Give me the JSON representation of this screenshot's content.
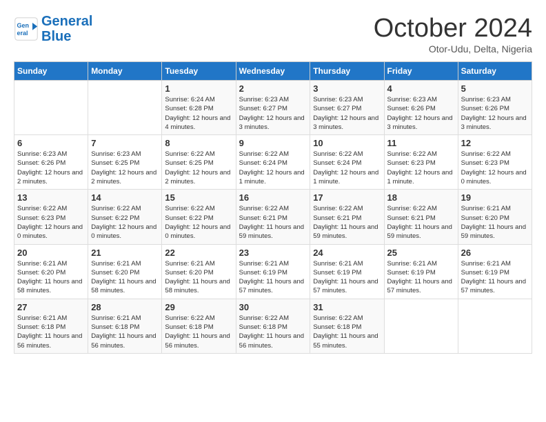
{
  "logo": {
    "line1": "General",
    "line2": "Blue"
  },
  "title": "October 2024",
  "location": "Otor-Udu, Delta, Nigeria",
  "days_of_week": [
    "Sunday",
    "Monday",
    "Tuesday",
    "Wednesday",
    "Thursday",
    "Friday",
    "Saturday"
  ],
  "weeks": [
    [
      {
        "day": "",
        "info": ""
      },
      {
        "day": "",
        "info": ""
      },
      {
        "day": "1",
        "info": "Sunrise: 6:24 AM\nSunset: 6:28 PM\nDaylight: 12 hours and 4 minutes."
      },
      {
        "day": "2",
        "info": "Sunrise: 6:23 AM\nSunset: 6:27 PM\nDaylight: 12 hours and 3 minutes."
      },
      {
        "day": "3",
        "info": "Sunrise: 6:23 AM\nSunset: 6:27 PM\nDaylight: 12 hours and 3 minutes."
      },
      {
        "day": "4",
        "info": "Sunrise: 6:23 AM\nSunset: 6:26 PM\nDaylight: 12 hours and 3 minutes."
      },
      {
        "day": "5",
        "info": "Sunrise: 6:23 AM\nSunset: 6:26 PM\nDaylight: 12 hours and 3 minutes."
      }
    ],
    [
      {
        "day": "6",
        "info": "Sunrise: 6:23 AM\nSunset: 6:26 PM\nDaylight: 12 hours and 2 minutes."
      },
      {
        "day": "7",
        "info": "Sunrise: 6:23 AM\nSunset: 6:25 PM\nDaylight: 12 hours and 2 minutes."
      },
      {
        "day": "8",
        "info": "Sunrise: 6:22 AM\nSunset: 6:25 PM\nDaylight: 12 hours and 2 minutes."
      },
      {
        "day": "9",
        "info": "Sunrise: 6:22 AM\nSunset: 6:24 PM\nDaylight: 12 hours and 1 minute."
      },
      {
        "day": "10",
        "info": "Sunrise: 6:22 AM\nSunset: 6:24 PM\nDaylight: 12 hours and 1 minute."
      },
      {
        "day": "11",
        "info": "Sunrise: 6:22 AM\nSunset: 6:23 PM\nDaylight: 12 hours and 1 minute."
      },
      {
        "day": "12",
        "info": "Sunrise: 6:22 AM\nSunset: 6:23 PM\nDaylight: 12 hours and 0 minutes."
      }
    ],
    [
      {
        "day": "13",
        "info": "Sunrise: 6:22 AM\nSunset: 6:23 PM\nDaylight: 12 hours and 0 minutes."
      },
      {
        "day": "14",
        "info": "Sunrise: 6:22 AM\nSunset: 6:22 PM\nDaylight: 12 hours and 0 minutes."
      },
      {
        "day": "15",
        "info": "Sunrise: 6:22 AM\nSunset: 6:22 PM\nDaylight: 12 hours and 0 minutes."
      },
      {
        "day": "16",
        "info": "Sunrise: 6:22 AM\nSunset: 6:21 PM\nDaylight: 11 hours and 59 minutes."
      },
      {
        "day": "17",
        "info": "Sunrise: 6:22 AM\nSunset: 6:21 PM\nDaylight: 11 hours and 59 minutes."
      },
      {
        "day": "18",
        "info": "Sunrise: 6:22 AM\nSunset: 6:21 PM\nDaylight: 11 hours and 59 minutes."
      },
      {
        "day": "19",
        "info": "Sunrise: 6:21 AM\nSunset: 6:20 PM\nDaylight: 11 hours and 59 minutes."
      }
    ],
    [
      {
        "day": "20",
        "info": "Sunrise: 6:21 AM\nSunset: 6:20 PM\nDaylight: 11 hours and 58 minutes."
      },
      {
        "day": "21",
        "info": "Sunrise: 6:21 AM\nSunset: 6:20 PM\nDaylight: 11 hours and 58 minutes."
      },
      {
        "day": "22",
        "info": "Sunrise: 6:21 AM\nSunset: 6:20 PM\nDaylight: 11 hours and 58 minutes."
      },
      {
        "day": "23",
        "info": "Sunrise: 6:21 AM\nSunset: 6:19 PM\nDaylight: 11 hours and 57 minutes."
      },
      {
        "day": "24",
        "info": "Sunrise: 6:21 AM\nSunset: 6:19 PM\nDaylight: 11 hours and 57 minutes."
      },
      {
        "day": "25",
        "info": "Sunrise: 6:21 AM\nSunset: 6:19 PM\nDaylight: 11 hours and 57 minutes."
      },
      {
        "day": "26",
        "info": "Sunrise: 6:21 AM\nSunset: 6:19 PM\nDaylight: 11 hours and 57 minutes."
      }
    ],
    [
      {
        "day": "27",
        "info": "Sunrise: 6:21 AM\nSunset: 6:18 PM\nDaylight: 11 hours and 56 minutes."
      },
      {
        "day": "28",
        "info": "Sunrise: 6:21 AM\nSunset: 6:18 PM\nDaylight: 11 hours and 56 minutes."
      },
      {
        "day": "29",
        "info": "Sunrise: 6:22 AM\nSunset: 6:18 PM\nDaylight: 11 hours and 56 minutes."
      },
      {
        "day": "30",
        "info": "Sunrise: 6:22 AM\nSunset: 6:18 PM\nDaylight: 11 hours and 56 minutes."
      },
      {
        "day": "31",
        "info": "Sunrise: 6:22 AM\nSunset: 6:18 PM\nDaylight: 11 hours and 55 minutes."
      },
      {
        "day": "",
        "info": ""
      },
      {
        "day": "",
        "info": ""
      }
    ]
  ]
}
